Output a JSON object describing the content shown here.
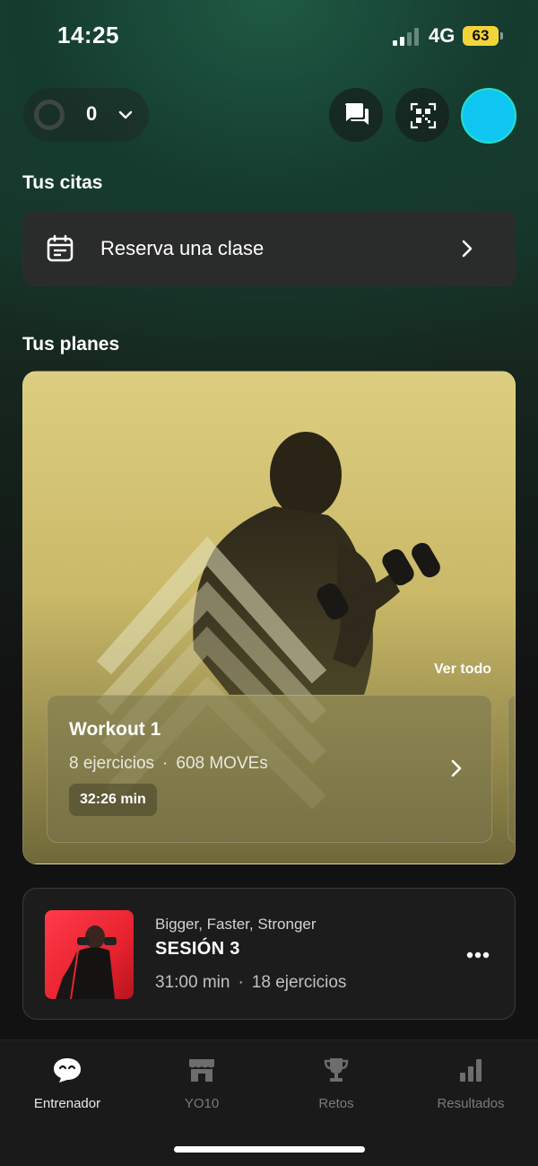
{
  "status_bar": {
    "time": "14:25",
    "network": "4G",
    "battery": "63"
  },
  "moves": {
    "count": "0"
  },
  "header": {
    "chat_icon": "chat-bubbles-icon",
    "qr_icon": "qr-code-icon",
    "avatar_color": "#0fc6f2"
  },
  "citas": {
    "section_title": "Tus citas",
    "card_label": "Reserva una clase"
  },
  "planes": {
    "section_title": "Tus planes",
    "see_all": "Ver todo",
    "workout": {
      "title": "Workout 1",
      "exercises": "8 ejercicios",
      "moves": "608 MOVEs",
      "duration": "32:26 min"
    }
  },
  "session": {
    "program": "Bigger, Faster, Stronger",
    "title": "SESIÓN 3",
    "duration": "31:00 min",
    "exercises": "18 ejercicios"
  },
  "tabs": [
    {
      "label": "Entrenador",
      "icon": "coach-face-icon",
      "active": true
    },
    {
      "label": "YO10",
      "icon": "store-icon",
      "active": false
    },
    {
      "label": "Retos",
      "icon": "trophy-icon",
      "active": false
    },
    {
      "label": "Resultados",
      "icon": "bar-chart-icon",
      "active": false
    }
  ],
  "colors": {
    "accent_battery": "#f2d43a",
    "avatar_border": "#24e1c9",
    "background": "#121212"
  }
}
